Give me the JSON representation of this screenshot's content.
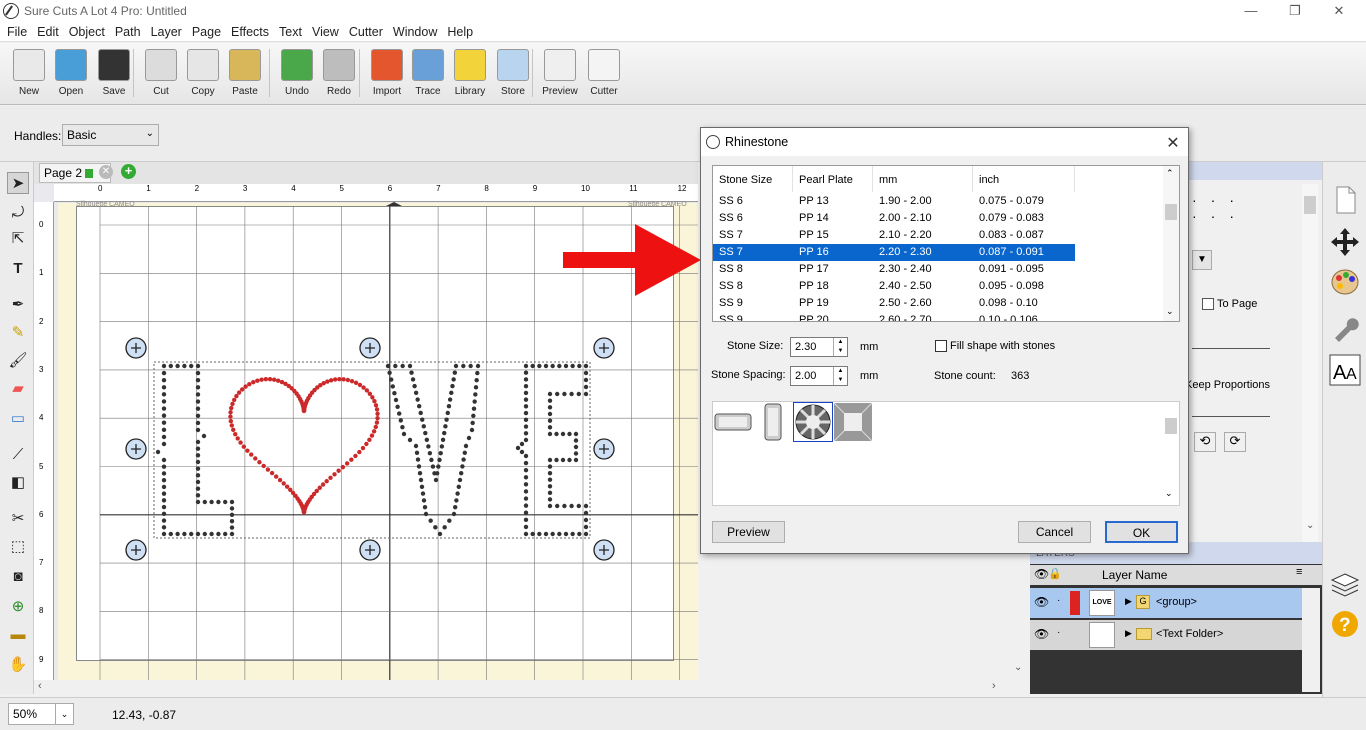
{
  "window": {
    "title": "Sure Cuts A Lot 4 Pro: Untitled",
    "min": "—",
    "max": "❐",
    "close": "✕"
  },
  "menu": [
    "File",
    "Edit",
    "Object",
    "Path",
    "Layer",
    "Page",
    "Effects",
    "Text",
    "View",
    "Cutter",
    "Window",
    "Help"
  ],
  "toolbar": [
    {
      "label": "New",
      "icon": "new-document-icon",
      "color": "#e9e9e9"
    },
    {
      "label": "Open",
      "icon": "open-folder-icon",
      "color": "#4a9ed8"
    },
    {
      "label": "Save",
      "icon": "save-disk-icon",
      "color": "#333333"
    },
    {
      "label": "Cut",
      "icon": "scissors-icon",
      "color": "#dcdcdc"
    },
    {
      "label": "Copy",
      "icon": "copy-icon",
      "color": "#e6e6e6"
    },
    {
      "label": "Paste",
      "icon": "paste-clipboard-icon",
      "color": "#d8b75a"
    },
    {
      "label": "Undo",
      "icon": "undo-arrow-icon",
      "color": "#4aa84a"
    },
    {
      "label": "Redo",
      "icon": "redo-arrow-icon",
      "color": "#bdbdbd"
    },
    {
      "label": "Import",
      "icon": "svg-import-icon",
      "color": "#e4572e"
    },
    {
      "label": "Trace",
      "icon": "trace-landscape-icon",
      "color": "#6aa0d8"
    },
    {
      "label": "Library",
      "icon": "library-star-icon",
      "color": "#f3d33a"
    },
    {
      "label": "Store",
      "icon": "store-cart-icon",
      "color": "#b8d4ef"
    },
    {
      "label": "Preview",
      "icon": "preview-magnifier-icon",
      "color": "#efefef"
    },
    {
      "label": "Cutter",
      "icon": "cutter-pen-icon",
      "color": "#f4f4f4"
    }
  ],
  "handles": {
    "label": "Handles:",
    "value": "Basic"
  },
  "page_tab": {
    "label": "Page 2",
    "close": "✕",
    "add": "+"
  },
  "ruler": {
    "h": [
      "0",
      "1",
      "2",
      "3",
      "4",
      "5",
      "6",
      "7",
      "8",
      "9",
      "10",
      "11",
      "12"
    ],
    "v": [
      "0",
      "1",
      "2",
      "3",
      "4",
      "5",
      "6",
      "7",
      "8",
      "9"
    ]
  },
  "canvas": {
    "art_text": "LOVE",
    "mat_label_left": "Silhouette CAMEO",
    "mat_label_right": "Silhouette CAMEO"
  },
  "zoom": {
    "value": "50%"
  },
  "coords": "12.43, -0.87",
  "right_panel": {
    "to_page": "To Page",
    "keep_proportions": "Keep Proportions"
  },
  "layers": {
    "title": "LAYERS",
    "col": "Layer Name",
    "rows": [
      {
        "name": "<group>",
        "badge": "G"
      },
      {
        "name": "<Text Folder>",
        "badge": ""
      }
    ]
  },
  "dialog": {
    "title": "Rhinestone",
    "columns": [
      "Stone Size",
      "Pearl Plate",
      "mm",
      "inch"
    ],
    "rows": [
      [
        "SS 6",
        "PP 13",
        "1.90 - 2.00",
        "0.075 - 0.079"
      ],
      [
        "SS 6",
        "PP 14",
        "2.00 - 2.10",
        "0.079 - 0.083"
      ],
      [
        "SS 7",
        "PP 15",
        "2.10 - 2.20",
        "0.083 - 0.087"
      ],
      [
        "SS 7",
        "PP 16",
        "2.20 - 2.30",
        "0.087 - 0.091"
      ],
      [
        "SS 8",
        "PP 17",
        "2.30 - 2.40",
        "0.091 - 0.095"
      ],
      [
        "SS 8",
        "PP 18",
        "2.40 - 2.50",
        "0.095 - 0.098"
      ],
      [
        "SS 9",
        "PP 19",
        "2.50 - 2.60",
        "0.098 - 0.10"
      ],
      [
        "SS 9",
        "PP 20",
        "2.60 - 2.70",
        "0.10 - 0.106"
      ]
    ],
    "selected_row": 3,
    "stone_size_label": "Stone Size:",
    "stone_size": "2.30",
    "unit": "mm",
    "spacing_label": "Stone Spacing:",
    "spacing": "2.00",
    "fill_label": "Fill shape with stones",
    "count_label": "Stone count:",
    "count": "363",
    "preview": "Preview",
    "cancel": "Cancel",
    "ok": "OK"
  },
  "annotation": {
    "arrow_color": "#ee1111"
  }
}
